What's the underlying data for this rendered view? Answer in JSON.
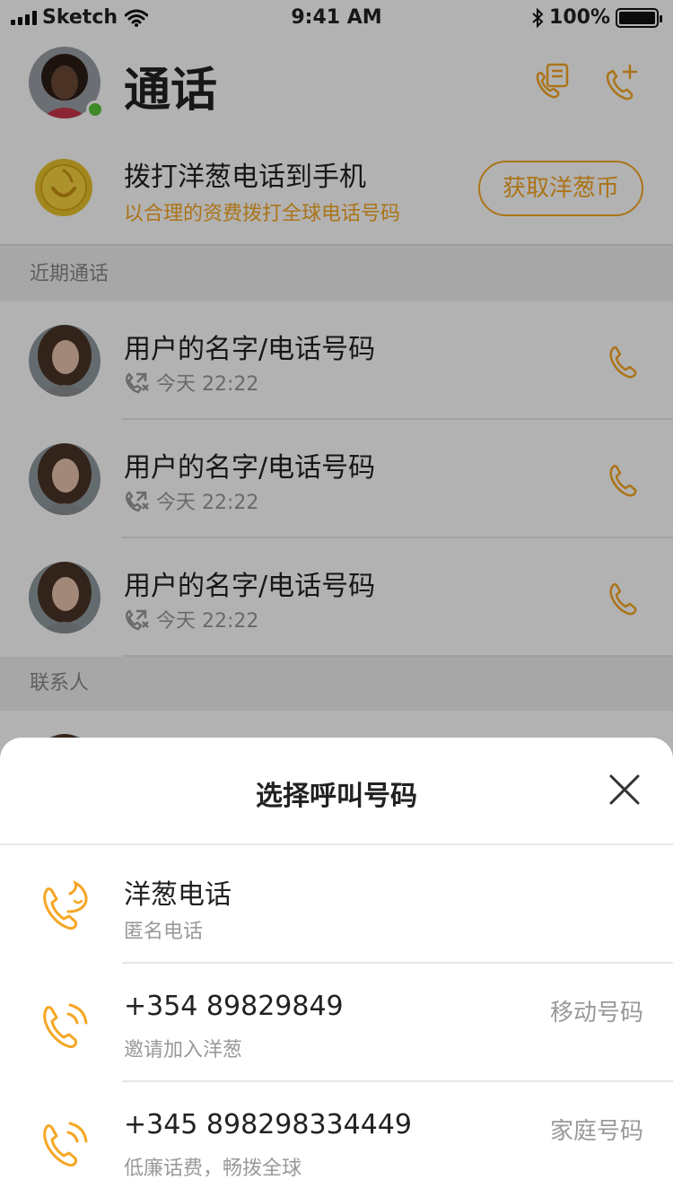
{
  "status_bar": {
    "carrier": "Sketch",
    "time": "9:41 AM",
    "battery": "100%"
  },
  "header": {
    "title": "通话"
  },
  "promo": {
    "title": "拨打洋葱电话到手机",
    "subtitle": "以合理的资费拨打全球电话号码",
    "button_label": "获取洋葱币"
  },
  "recent": {
    "section_label": "近期通话",
    "items": [
      {
        "name": "用户的名字/电话号码",
        "time": "今天 22:22"
      },
      {
        "name": "用户的名字/电话号码",
        "time": "今天 22:22"
      },
      {
        "name": "用户的名字/电话号码",
        "time": "今天 22:22"
      }
    ]
  },
  "contacts": {
    "section_label": "联系人"
  },
  "sheet": {
    "title": "选择呼叫号码",
    "options": [
      {
        "title": "洋葱电话",
        "subtitle": "匿名电话",
        "tag": ""
      },
      {
        "title": "+354 89829849",
        "subtitle": "邀请加入洋葱",
        "tag": "移动号码"
      },
      {
        "title": "+345 898298334449",
        "subtitle": "低廉话费，畅拨全球",
        "tag": "家庭号码"
      }
    ]
  },
  "colors": {
    "accent": "#f5a623",
    "online": "#5cc43b"
  }
}
